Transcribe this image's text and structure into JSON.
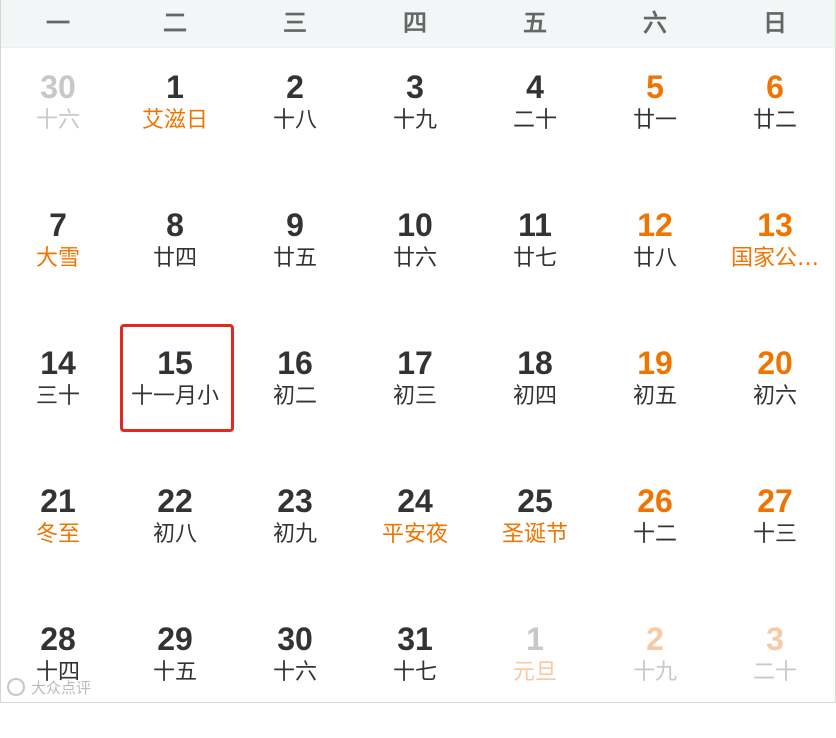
{
  "weekdays": [
    "一",
    "二",
    "三",
    "四",
    "五",
    "六",
    "日"
  ],
  "weeks": [
    [
      {
        "d": "30",
        "s": "十六",
        "other": true
      },
      {
        "d": "1",
        "s": "艾滋日",
        "hol": true
      },
      {
        "d": "2",
        "s": "十八"
      },
      {
        "d": "3",
        "s": "十九"
      },
      {
        "d": "4",
        "s": "二十"
      },
      {
        "d": "5",
        "s": "廿一",
        "we": true
      },
      {
        "d": "6",
        "s": "廿二",
        "we": true
      }
    ],
    [
      {
        "d": "7",
        "s": "大雪",
        "hol": true
      },
      {
        "d": "8",
        "s": "廿四"
      },
      {
        "d": "9",
        "s": "廿五"
      },
      {
        "d": "10",
        "s": "廿六"
      },
      {
        "d": "11",
        "s": "廿七"
      },
      {
        "d": "12",
        "s": "廿八",
        "we": true
      },
      {
        "d": "13",
        "s": "国家公…",
        "we": true,
        "hol": true
      }
    ],
    [
      {
        "d": "14",
        "s": "三十"
      },
      {
        "d": "15",
        "s": "十一月小",
        "today": true
      },
      {
        "d": "16",
        "s": "初二"
      },
      {
        "d": "17",
        "s": "初三"
      },
      {
        "d": "18",
        "s": "初四"
      },
      {
        "d": "19",
        "s": "初五",
        "we": true
      },
      {
        "d": "20",
        "s": "初六",
        "we": true
      }
    ],
    [
      {
        "d": "21",
        "s": "冬至",
        "hol": true
      },
      {
        "d": "22",
        "s": "初八"
      },
      {
        "d": "23",
        "s": "初九"
      },
      {
        "d": "24",
        "s": "平安夜",
        "hol": true
      },
      {
        "d": "25",
        "s": "圣诞节",
        "hol": true
      },
      {
        "d": "26",
        "s": "十二",
        "we": true
      },
      {
        "d": "27",
        "s": "十三",
        "we": true
      }
    ],
    [
      {
        "d": "28",
        "s": "十四"
      },
      {
        "d": "29",
        "s": "十五"
      },
      {
        "d": "30",
        "s": "十六"
      },
      {
        "d": "31",
        "s": "十七"
      },
      {
        "d": "1",
        "s": "元旦",
        "other": true,
        "hol": true
      },
      {
        "d": "2",
        "s": "十九",
        "other": true,
        "we": true
      },
      {
        "d": "3",
        "s": "二十",
        "other": true,
        "we": true
      }
    ]
  ],
  "watermark": "大众点评",
  "colors": {
    "accent": "#f07400",
    "today_border": "#e02a1e",
    "muted": "#c8c8c8"
  }
}
